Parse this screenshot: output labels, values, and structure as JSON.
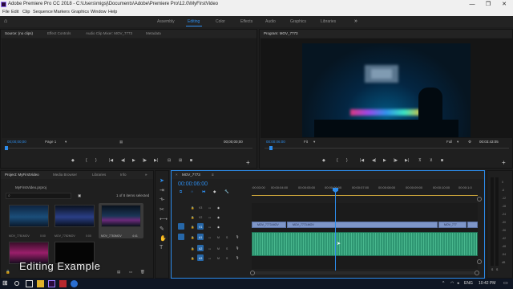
{
  "titlebar": {
    "title": "Adobe Premiere Pro CC 2018 - C:\\Users\\migsj\\Documents\\Adobe\\Premiere Pro\\12.0\\MyFirstVideo",
    "minimize": "—",
    "maximize": "❐",
    "close": "✕"
  },
  "menu": [
    "File",
    "Edit",
    "Clip",
    "Sequence",
    "Markers",
    "Graphics",
    "Window",
    "Help"
  ],
  "workspaces": {
    "items": [
      "Assembly",
      "Editing",
      "Color",
      "Effects",
      "Audio",
      "Graphics",
      "Libraries"
    ],
    "active": "Editing",
    "more": "»"
  },
  "source_panel": {
    "tabs": [
      "Source: (no clips)",
      "Effect Controls",
      "Audio Clip Mixer: MOV_7773",
      "Metadata"
    ],
    "timecode_left": "00;00;00;00",
    "page": "Page 1",
    "timecode_right": "00;00;00;00"
  },
  "program_panel": {
    "tab": "Program: MOV_7773",
    "timecode_left": "00:00:06:00",
    "fit": "Fit",
    "quality": "Full",
    "timecode_right": "00:03:43:05"
  },
  "project_panel": {
    "tabs": [
      "Project: MyFirstVideo",
      "Media Browser",
      "Libraries",
      "Info"
    ],
    "project_file": "MyFirstVideo.prproj",
    "items_selected": "1 of 8 items selected",
    "items": [
      {
        "name": "MOV_7781MOV",
        "duration": "0:00"
      },
      {
        "name": "MOV_7782MOV",
        "duration": "0:00"
      },
      {
        "name": "MOV_7783MOV",
        "duration": "4:41"
      }
    ]
  },
  "timeline": {
    "tab": "MOV_7773",
    "timecode": "00:00:06:00",
    "ruler": [
      ":00:03:00",
      "00:00:04:00",
      "00:00:05:00",
      "00:00:06:00",
      "00:00:07:00",
      "00:00:08:00",
      "00:00:09:00",
      "00:00:10:00",
      "00:00:1:0"
    ],
    "video_tracks": [
      "V3",
      "V2",
      "V1"
    ],
    "audio_tracks": [
      "A1",
      "A2",
      "A3"
    ],
    "track_buttons": [
      "M",
      "S"
    ],
    "clips": [
      "MOV_7773.MOV",
      "MOV_7773.MOV",
      "MOV_777"
    ]
  },
  "meters": [
    "0",
    "-6",
    "-12",
    "-18",
    "-24",
    "-30",
    "-36",
    "-42",
    "-48",
    "-54",
    "dB"
  ],
  "caption": "Editing Example",
  "taskbar": {
    "language": "ENG",
    "time": "10:42 PM"
  },
  "colors": {
    "accent": "#2d8ceb",
    "video_clip": "#7e96c8",
    "audio_clip": "#2e9672",
    "playhead": "#2d8ceb"
  }
}
